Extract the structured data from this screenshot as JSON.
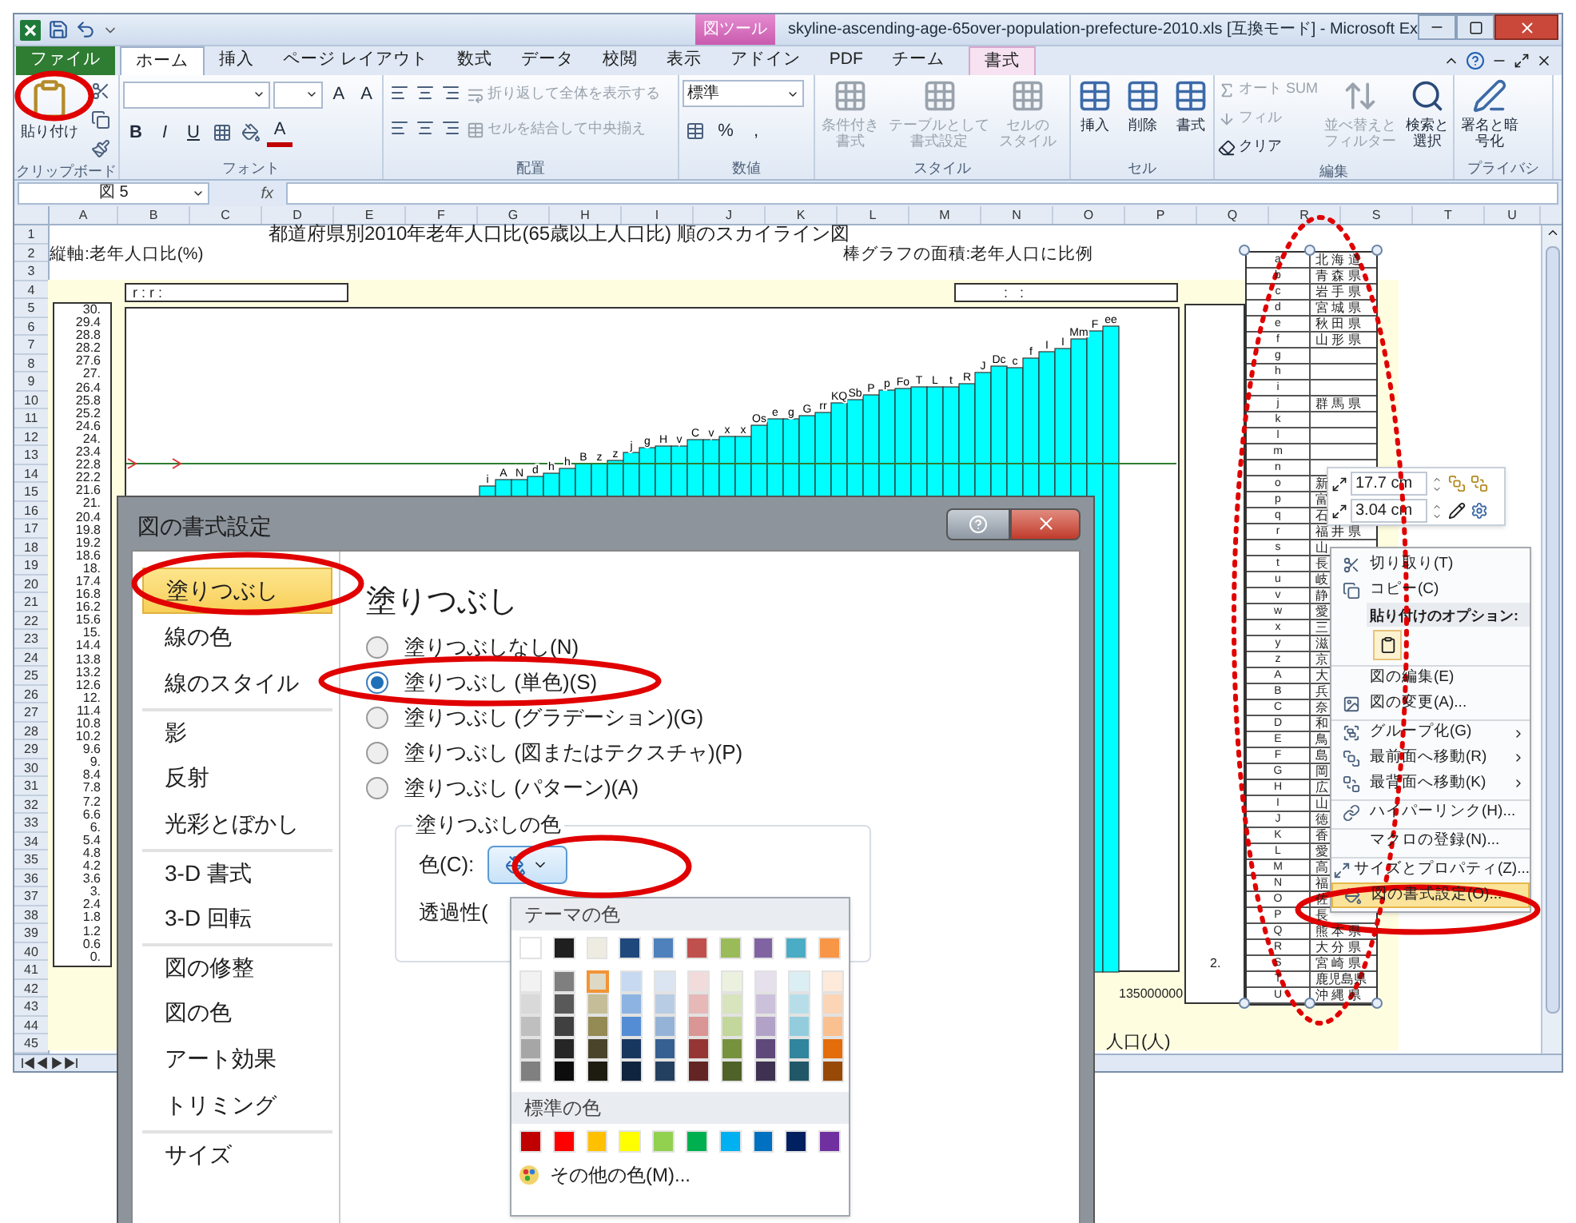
{
  "window": {
    "title": "skyline-ascending-age-65over-population-prefecture-2010.xls  [互換モード] - Microsoft Ex",
    "context_group": "図ツール"
  },
  "tabs": [
    {
      "label": "ファイル",
      "kind": "file",
      "selected": false
    },
    {
      "label": "ホーム",
      "kind": "tab",
      "selected": true
    },
    {
      "label": "挿入",
      "kind": "tab",
      "selected": false
    },
    {
      "label": "ページ レイアウト",
      "kind": "tab",
      "selected": false
    },
    {
      "label": "数式",
      "kind": "tab",
      "selected": false
    },
    {
      "label": "データ",
      "kind": "tab",
      "selected": false
    },
    {
      "label": "校閲",
      "kind": "tab",
      "selected": false
    },
    {
      "label": "表示",
      "kind": "tab",
      "selected": false
    },
    {
      "label": "アドイン",
      "kind": "tab",
      "selected": false
    },
    {
      "label": "PDF",
      "kind": "tab",
      "selected": false
    },
    {
      "label": "チーム",
      "kind": "tab",
      "selected": false
    },
    {
      "label": "書式",
      "kind": "context",
      "selected": false
    }
  ],
  "ribbon": [
    {
      "label": "クリップボード",
      "controls": [
        {
          "kind": "large",
          "label": "貼り付け",
          "disabled": false
        }
      ]
    },
    {
      "label": "フォント",
      "controls": [
        {
          "kind": "combo"
        },
        {
          "kind": "combo"
        },
        {
          "kind": "glyph",
          "label": "A"
        },
        {
          "kind": "glyph",
          "label": "A"
        },
        {
          "kind": "glyph",
          "label": "B"
        },
        {
          "kind": "glyph",
          "label": "I"
        },
        {
          "kind": "glyph",
          "label": "U"
        },
        {
          "kind": "glyph",
          "label": "A"
        }
      ]
    },
    {
      "label": "配置",
      "controls": [
        {
          "kind": "small",
          "label": "折り返して全体を表示する",
          "disabled": true
        },
        {
          "kind": "small",
          "label": "セルを結合して中央揃え",
          "disabled": true
        }
      ]
    },
    {
      "label": "数値",
      "controls": [
        {
          "kind": "combo",
          "label": "標準"
        },
        {
          "kind": "glyph",
          "label": "%"
        },
        {
          "kind": "glyph",
          "label": ","
        }
      ]
    },
    {
      "label": "スタイル",
      "controls": [
        {
          "kind": "large",
          "label": "条件付き書式",
          "disabled": true
        },
        {
          "kind": "large",
          "label": "テーブルとして書式設定",
          "disabled": true
        },
        {
          "kind": "large",
          "label": "セルのスタイル",
          "disabled": true
        }
      ]
    },
    {
      "label": "セル",
      "controls": [
        {
          "kind": "large",
          "label": "挿入",
          "disabled": false
        },
        {
          "kind": "large",
          "label": "削除",
          "disabled": false
        },
        {
          "kind": "large",
          "label": "書式",
          "disabled": false
        }
      ]
    },
    {
      "label": "編集",
      "controls": [
        {
          "kind": "small",
          "label": "オート SUM",
          "disabled": true
        },
        {
          "kind": "small",
          "label": "フィル",
          "disabled": true
        },
        {
          "kind": "small",
          "label": "クリア",
          "disabled": false
        },
        {
          "kind": "large",
          "label": "並べ替えとフィルター",
          "disabled": true
        },
        {
          "kind": "large",
          "label": "検索と選択",
          "disabled": false
        }
      ]
    },
    {
      "label": "プライバシ",
      "controls": [
        {
          "kind": "large",
          "label": "署名と暗号化",
          "disabled": false
        }
      ]
    }
  ],
  "formula_bar": {
    "name_box": "図 5",
    "fx": "fx"
  },
  "columns": [
    "A",
    "B",
    "C",
    "D",
    "E",
    "F",
    "G",
    "H",
    "I",
    "J",
    "K",
    "L",
    "M",
    "N",
    "O",
    "P",
    "Q",
    "R",
    "S",
    "T",
    "U"
  ],
  "rows": [
    "1",
    "2",
    "3",
    "4",
    "5",
    "6",
    "7",
    "8",
    "9",
    "10",
    "11",
    "12",
    "13",
    "14",
    "15",
    "16",
    "17",
    "18",
    "19",
    "20",
    "21",
    "22",
    "23",
    "24",
    "25",
    "26",
    "27",
    "28",
    "29",
    "30",
    "31",
    "32",
    "33",
    "34",
    "35",
    "36",
    "37",
    "38",
    "39",
    "40",
    "41",
    "42",
    "43",
    "44",
    "45"
  ],
  "sheet": {
    "title": "都道府県別2010年老年人口比(65歳以上人口比) 順のスカイライン図",
    "y_axis_label": "縦軸:老年人口比(%)",
    "area_note": "棒グラフの面積:老年人口に比例",
    "legend_left": "r : r :",
    "legend_right": ":   :",
    "y_ticks": [
      "30.",
      "29.4",
      "28.8",
      "28.2",
      "27.6",
      "27.",
      "26.4",
      "25.8",
      "25.2",
      "24.6",
      "24.",
      "23.4",
      "22.8",
      "22.2",
      "21.6",
      "21.",
      "20.4",
      "19.8",
      "19.2",
      "18.6",
      "18.",
      "17.4",
      "16.8",
      "16.2",
      "15.6",
      "15.",
      "14.4",
      "13.8",
      "13.2",
      "12.6",
      "12.",
      "11.4",
      "10.8",
      "10.2",
      "9.6",
      "9.",
      "8.4",
      "7.8",
      "7.2",
      "6.6",
      "6.",
      "5.4",
      "4.8",
      "4.2",
      "3.6",
      "3.",
      "2.4",
      "1.8",
      "1.2",
      "0.6",
      "0."
    ],
    "bar_labels": [
      "i",
      "A",
      "N",
      "d",
      "h",
      "h",
      "B",
      "z",
      "z",
      "j",
      "g",
      "H",
      "v",
      "C",
      "v",
      "x",
      "x",
      "Os",
      "e",
      "g",
      "G",
      "rr",
      "KQ",
      "Sb",
      "P",
      "p",
      "Fo",
      "T",
      "L",
      "t",
      "R",
      "J",
      "Dc",
      "c",
      "f",
      "I",
      "I",
      "Mm",
      "F",
      "ee"
    ],
    "x_tick": "135000000",
    "side_tick": "2.",
    "x_axis_label": "人口(人)"
  },
  "prefecture_table": [
    {
      "code": "a",
      "name": "北 海 道"
    },
    {
      "code": "b",
      "name": "青 森 県"
    },
    {
      "code": "c",
      "name": "岩 手 県"
    },
    {
      "code": "d",
      "name": "宮 城 県"
    },
    {
      "code": "e",
      "name": "秋 田 県"
    },
    {
      "code": "f",
      "name": "山 形 県"
    },
    {
      "code": "g"
    },
    {
      "code": "h"
    },
    {
      "code": "i"
    },
    {
      "code": "j",
      "name": "群 馬 県"
    },
    {
      "code": "k"
    },
    {
      "code": "l"
    },
    {
      "code": "m"
    },
    {
      "code": "n"
    },
    {
      "code": "o",
      "name": "新"
    },
    {
      "code": "p",
      "name": "富"
    },
    {
      "code": "q",
      "name": "石"
    },
    {
      "code": "r",
      "name": "福 井 県"
    },
    {
      "code": "s",
      "name": "山"
    },
    {
      "code": "t",
      "name": "長"
    },
    {
      "code": "u",
      "name": "岐"
    },
    {
      "code": "v",
      "name": "静"
    },
    {
      "code": "w",
      "name": "愛"
    },
    {
      "code": "x",
      "name": "三"
    },
    {
      "code": "y",
      "name": "滋"
    },
    {
      "code": "z",
      "name": "京"
    },
    {
      "code": "A",
      "name": "大"
    },
    {
      "code": "B",
      "name": "兵"
    },
    {
      "code": "C",
      "name": "奈"
    },
    {
      "code": "D",
      "name": "和"
    },
    {
      "code": "E",
      "name": "鳥"
    },
    {
      "code": "F",
      "name": "島"
    },
    {
      "code": "G",
      "name": "岡"
    },
    {
      "code": "H",
      "name": "広"
    },
    {
      "code": "I",
      "name": "山"
    },
    {
      "code": "J",
      "name": "徳"
    },
    {
      "code": "K",
      "name": "香"
    },
    {
      "code": "L",
      "name": "愛"
    },
    {
      "code": "M",
      "name": "高"
    },
    {
      "code": "N",
      "name": "福"
    },
    {
      "code": "O",
      "name": "佐"
    },
    {
      "code": "P",
      "name": "長"
    },
    {
      "code": "Q",
      "name": "熊 本 県"
    },
    {
      "code": "R",
      "name": "大 分 県"
    },
    {
      "code": "S",
      "name": "宮 崎 県"
    },
    {
      "code": "T",
      "name": "鹿児島県"
    },
    {
      "code": "U",
      "name": "沖 縄 県"
    }
  ],
  "size_toolbar": {
    "height": "17.7 cm",
    "width": "3.04 cm"
  },
  "context_menu": [
    {
      "kind": "item",
      "label": "切り取り(T)",
      "separated": false,
      "selected": false
    },
    {
      "kind": "item",
      "label": "コピー(C)",
      "separated": false,
      "selected": false
    },
    {
      "kind": "header",
      "label": "貼り付けのオプション:"
    },
    {
      "kind": "paste",
      "selected": false
    },
    {
      "kind": "item",
      "label": "図の編集(E)",
      "separated": true,
      "selected": false
    },
    {
      "kind": "item",
      "label": "図の変更(A)...",
      "separated": false,
      "selected": false
    },
    {
      "kind": "submenu",
      "label": "グループ化(G)",
      "separated": true,
      "selected": false
    },
    {
      "kind": "submenu",
      "label": "最前面へ移動(R)",
      "separated": false,
      "selected": false
    },
    {
      "kind": "submenu",
      "label": "最背面へ移動(K)",
      "separated": false,
      "selected": false
    },
    {
      "kind": "item",
      "label": "ハイパーリンク(H)...",
      "separated": true,
      "selected": false
    },
    {
      "kind": "item",
      "label": "マクロの登録(N)...",
      "separated": true,
      "selected": false
    },
    {
      "kind": "item",
      "label": "サイズとプロパティ(Z)...",
      "separated": true,
      "selected": false
    },
    {
      "kind": "item",
      "label": "図の書式設定(O)...",
      "separated": false,
      "selected": true
    }
  ],
  "dialog": {
    "title": "図の書式設定",
    "nav": [
      {
        "label": "塗りつぶし",
        "selected": true,
        "separated": false
      },
      {
        "label": "線の色",
        "selected": false,
        "separated": false
      },
      {
        "label": "線のスタイル",
        "selected": false,
        "separated": false
      },
      {
        "label": "影",
        "selected": false,
        "separated": true
      },
      {
        "label": "反射",
        "selected": false,
        "separated": false
      },
      {
        "label": "光彩とぼかし",
        "selected": false,
        "separated": false
      },
      {
        "label": "3-D 書式",
        "selected": false,
        "separated": true
      },
      {
        "label": "3-D 回転",
        "selected": false,
        "separated": false
      },
      {
        "label": "図の修整",
        "selected": false,
        "separated": true
      },
      {
        "label": "図の色",
        "selected": false,
        "separated": false
      },
      {
        "label": "アート効果",
        "selected": false,
        "separated": false
      },
      {
        "label": "トリミング",
        "selected": false,
        "separated": false
      },
      {
        "label": "サイズ",
        "selected": false,
        "separated": true
      }
    ],
    "heading": "塗りつぶし",
    "fill_options": [
      {
        "label": "塗りつぶしなし(N)",
        "selected": false
      },
      {
        "label": "塗りつぶし (単色)(S)",
        "selected": true
      },
      {
        "label": "塗りつぶし (グラデーション)(G)",
        "selected": false
      },
      {
        "label": "塗りつぶし (図またはテクスチャ)(P)",
        "selected": false
      },
      {
        "label": "塗りつぶし (パターン)(A)",
        "selected": false
      }
    ],
    "color_group": "塗りつぶしの色",
    "color_label": "色(C):",
    "transparency_label": "透過性("
  },
  "palette": {
    "theme_header": "テーマの色",
    "theme_colors": [
      {
        "color": "#ffffff"
      },
      {
        "color": "#1f1f1f"
      },
      {
        "color": "#eeece1"
      },
      {
        "color": "#1f497d"
      },
      {
        "color": "#4f81bd"
      },
      {
        "color": "#c0504d"
      },
      {
        "color": "#9bbb59"
      },
      {
        "color": "#8064a2"
      },
      {
        "color": "#4bacc6"
      },
      {
        "color": "#f79646"
      }
    ],
    "shade_columns": [
      [
        {
          "color": "#f2f2f2",
          "selected": false
        },
        {
          "color": "#d9d9d9",
          "selected": false
        },
        {
          "color": "#bfbfbf",
          "selected": false
        },
        {
          "color": "#a6a6a6",
          "selected": false
        },
        {
          "color": "#808080",
          "selected": false
        }
      ],
      [
        {
          "color": "#7f7f7f",
          "selected": false
        },
        {
          "color": "#595959",
          "selected": false
        },
        {
          "color": "#404040",
          "selected": false
        },
        {
          "color": "#262626",
          "selected": false
        },
        {
          "color": "#0d0d0d",
          "selected": false
        }
      ],
      [
        {
          "color": "#ddd9c4",
          "selected": true
        },
        {
          "color": "#c4bd97",
          "selected": false
        },
        {
          "color": "#948a54",
          "selected": false
        },
        {
          "color": "#4a452a",
          "selected": false
        },
        {
          "color": "#1e1c11",
          "selected": false
        }
      ],
      [
        {
          "color": "#c6d9f1",
          "selected": false
        },
        {
          "color": "#8db3e2",
          "selected": false
        },
        {
          "color": "#548dd4",
          "selected": false
        },
        {
          "color": "#17375e",
          "selected": false
        },
        {
          "color": "#0f243e",
          "selected": false
        }
      ],
      [
        {
          "color": "#dbe5f1",
          "selected": false
        },
        {
          "color": "#b8cce4",
          "selected": false
        },
        {
          "color": "#95b3d7",
          "selected": false
        },
        {
          "color": "#366092",
          "selected": false
        },
        {
          "color": "#244061",
          "selected": false
        }
      ],
      [
        {
          "color": "#f2dcdb",
          "selected": false
        },
        {
          "color": "#e6b9b8",
          "selected": false
        },
        {
          "color": "#da9694",
          "selected": false
        },
        {
          "color": "#963634",
          "selected": false
        },
        {
          "color": "#632523",
          "selected": false
        }
      ],
      [
        {
          "color": "#ebf1de",
          "selected": false
        },
        {
          "color": "#d7e4bd",
          "selected": false
        },
        {
          "color": "#c3d69b",
          "selected": false
        },
        {
          "color": "#76923c",
          "selected": false
        },
        {
          "color": "#4f6228",
          "selected": false
        }
      ],
      [
        {
          "color": "#e5e0ec",
          "selected": false
        },
        {
          "color": "#ccc1da",
          "selected": false
        },
        {
          "color": "#b3a2c7",
          "selected": false
        },
        {
          "color": "#5f497a",
          "selected": false
        },
        {
          "color": "#3f3151",
          "selected": false
        }
      ],
      [
        {
          "color": "#dbeef4",
          "selected": false
        },
        {
          "color": "#b7dee8",
          "selected": false
        },
        {
          "color": "#93cddd",
          "selected": false
        },
        {
          "color": "#31859c",
          "selected": false
        },
        {
          "color": "#205867",
          "selected": false
        }
      ],
      [
        {
          "color": "#fdeada",
          "selected": false
        },
        {
          "color": "#fbd5b5",
          "selected": false
        },
        {
          "color": "#fac090",
          "selected": false
        },
        {
          "color": "#e46c0a",
          "selected": false
        },
        {
          "color": "#984807",
          "selected": false
        }
      ]
    ],
    "standard_header": "標準の色",
    "standard_colors": [
      {
        "color": "#c00000"
      },
      {
        "color": "#ff0000"
      },
      {
        "color": "#ffc000"
      },
      {
        "color": "#ffff00"
      },
      {
        "color": "#92d050"
      },
      {
        "color": "#00b050"
      },
      {
        "color": "#00b0f0"
      },
      {
        "color": "#0070c0"
      },
      {
        "color": "#002060"
      },
      {
        "color": "#7030a0"
      }
    ],
    "more_colors": "その他の色(M)..."
  }
}
